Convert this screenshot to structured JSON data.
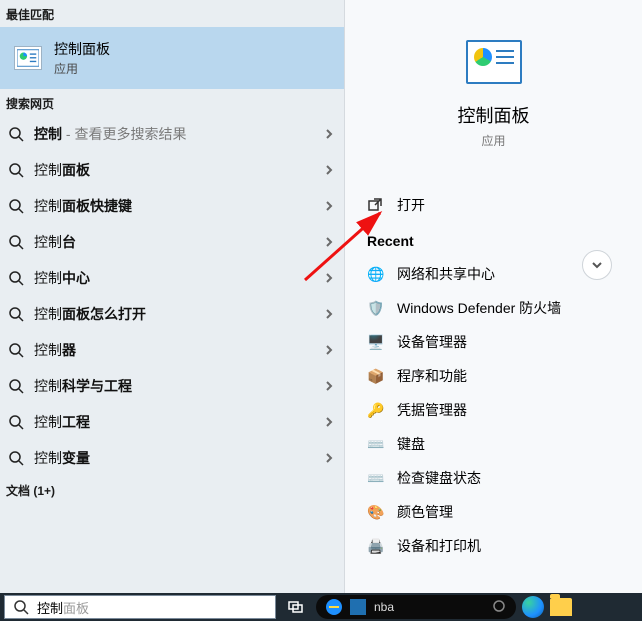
{
  "left": {
    "best_label": "最佳匹配",
    "best_match": {
      "title": "控制面板",
      "sub": "应用"
    },
    "web_label": "搜索网页",
    "doc_label": "文档 (1+)",
    "items": [
      {
        "pre": "",
        "bold": "控制",
        "post": " - 查看更多搜索结果",
        "gray_post": true
      },
      {
        "pre": "控制",
        "bold": "面板",
        "post": ""
      },
      {
        "pre": "控制",
        "bold": "面板快捷键",
        "post": ""
      },
      {
        "pre": "控制",
        "bold": "台",
        "post": ""
      },
      {
        "pre": "控制",
        "bold": "中心",
        "post": ""
      },
      {
        "pre": "控制",
        "bold": "面板怎么打开",
        "post": ""
      },
      {
        "pre": "控制",
        "bold": "器",
        "post": ""
      },
      {
        "pre": "控制",
        "bold": "科学与工程",
        "post": ""
      },
      {
        "pre": "控制",
        "bold": "工程",
        "post": ""
      },
      {
        "pre": "控制",
        "bold": "变量",
        "post": ""
      }
    ]
  },
  "right": {
    "title": "控制面板",
    "sub": "应用",
    "open": "打开",
    "recent_label": "Recent",
    "recent": [
      {
        "label": "网络和共享中心",
        "emoji": "🌐"
      },
      {
        "label": "Windows Defender 防火墙",
        "emoji": "🛡️"
      },
      {
        "label": "设备管理器",
        "emoji": "🖥️"
      },
      {
        "label": "程序和功能",
        "emoji": "📦"
      },
      {
        "label": "凭据管理器",
        "emoji": "🔑"
      },
      {
        "label": "键盘",
        "emoji": "⌨️"
      },
      {
        "label": "检查键盘状态",
        "emoji": "⌨️"
      },
      {
        "label": "颜色管理",
        "emoji": "🎨"
      },
      {
        "label": "设备和打印机",
        "emoji": "🖨️"
      }
    ]
  },
  "taskbar": {
    "typed": "控制",
    "ghost": "面板",
    "pill_text": "nba"
  }
}
